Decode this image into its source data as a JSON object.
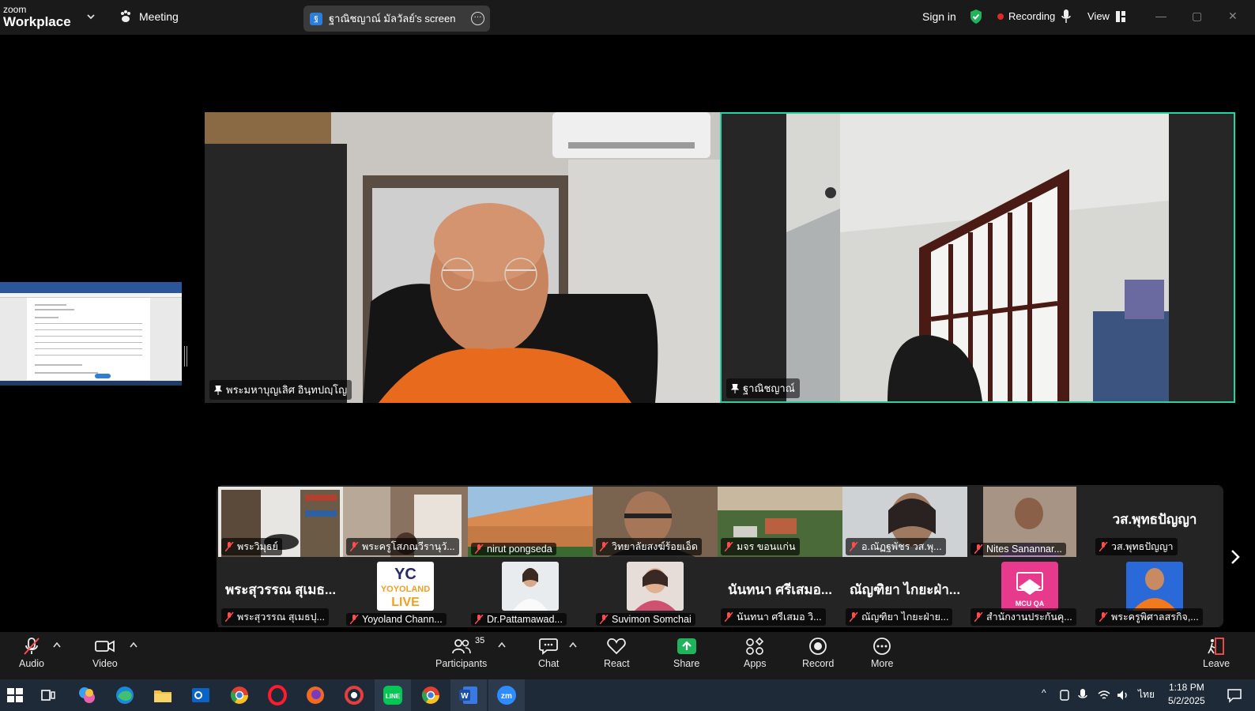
{
  "app": {
    "logo_line1": "zoom",
    "logo_line2": "Workplace",
    "meeting_label": "Meeting",
    "screen_pill_label": "ฐาณิชญาณ์ มัลวัลย์'s screen",
    "sign_in": "Sign in",
    "recording": "Recording",
    "view": "View",
    "accent": "#23d5a5",
    "recording_color": "#e02828"
  },
  "main_videos": [
    {
      "name": "พระมหาบุญเลิศ อินฺทปญฺโญ"
    },
    {
      "name": "ฐาณิชญาณ์"
    }
  ],
  "gallery": {
    "row1": [
      {
        "name": "พระวิมุธย์",
        "big": ""
      },
      {
        "name": "พระครูโสภณวีรานุวั...",
        "big": ""
      },
      {
        "name": "nirut pongseda",
        "big": ""
      },
      {
        "name": "วิทยาลัยสงฆ์ร้อยเอ็ด",
        "big": ""
      },
      {
        "name": "มจร ขอนแก่น",
        "big": ""
      },
      {
        "name": "อ.ณัฏฐพัชร วส.พุ...",
        "big": ""
      },
      {
        "name": "Nites Sanannar...",
        "big": ""
      },
      {
        "name": "วส.พุทธปัญญา",
        "big": "วส.พุทธปัญญา"
      }
    ],
    "row2": [
      {
        "name": "พระสุวรรณ สุเมธปุ...",
        "big": "พระสุวรรณ สุเมธ..."
      },
      {
        "name": "Yoyoland Chann...",
        "big": ""
      },
      {
        "name": "Dr.Pattamawad...",
        "big": ""
      },
      {
        "name": "Suvimon Somchai",
        "big": ""
      },
      {
        "name": "นันทนา ศรีเสมอ วิ...",
        "big": "นันทนา ศรีเสมอ..."
      },
      {
        "name": "ณัญฑิยา ไกยะฝ่าย...",
        "big": "ณัญฑิยา ไกยะฝ่า..."
      },
      {
        "name": "สำนักงานประกันคุ...",
        "big": ""
      },
      {
        "name": "พระครูพิศาลสรกิจ,...",
        "big": ""
      }
    ],
    "yoyoland_logo_text": "YC YOYOLAND LIVE",
    "mcu_qa_logo_text": "MCU QA"
  },
  "toolbar": {
    "audio": "Audio",
    "video": "Video",
    "participants": "Participants",
    "participants_count": "35",
    "chat": "Chat",
    "react": "React",
    "share": "Share",
    "apps": "Apps",
    "record": "Record",
    "more": "More",
    "leave": "Leave"
  },
  "taskbar": {
    "time": "1:18 PM",
    "date": "5/2/2025",
    "language": "ไทย"
  }
}
